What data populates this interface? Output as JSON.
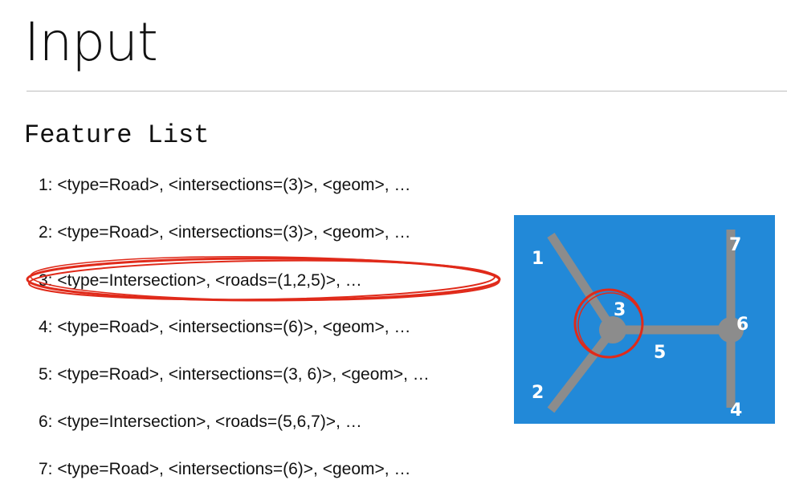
{
  "header": {
    "title": "Input"
  },
  "section": {
    "title": "Feature List"
  },
  "features": [
    "1: <type=Road>, <intersections=(3)>, <geom>, …",
    "2: <type=Road>, <intersections=(3)>, <geom>, …",
    "3: <type=Intersection>, <roads=(1,2,5)>, …",
    "4: <type=Road>, <intersections=(6)>, <geom>, …",
    "5: <type=Road>, <intersections=(3, 6)>, <geom>, …",
    "6: <type=Intersection>, <roads=(5,6,7)>, …",
    "7: <type=Road>, <intersections=(6)>, <geom>, …"
  ],
  "map": {
    "labels": [
      "1",
      "2",
      "3",
      "4",
      "5",
      "6",
      "7"
    ]
  },
  "colors": {
    "map_background": "#2289d8",
    "road": "#8c8c8c",
    "highlight": "#e02a1a",
    "label": "#ffffff"
  }
}
